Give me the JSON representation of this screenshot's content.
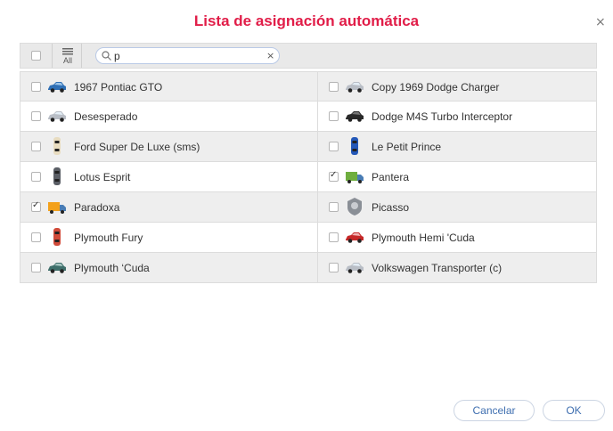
{
  "dialog": {
    "title": "Lista de asignación automática",
    "close_glyph": "×"
  },
  "toolbar": {
    "select_all_checked": false,
    "all_label": "All",
    "search": {
      "value": "p",
      "placeholder": "",
      "clear_glyph": "×"
    }
  },
  "items": [
    {
      "label": "1967 Pontiac GTO",
      "checked": false,
      "icon": "blue-sports-car-icon"
    },
    {
      "label": "Copy 1969 Dodge Charger",
      "checked": false,
      "icon": "silver-car-icon"
    },
    {
      "label": "Desesperado",
      "checked": false,
      "icon": "silver-car-icon"
    },
    {
      "label": "Dodge M4S Turbo Interceptor",
      "checked": false,
      "icon": "black-sports-car-icon"
    },
    {
      "label": "Ford Super De Luxe (sms)",
      "checked": false,
      "icon": "beige-car-top-icon"
    },
    {
      "label": "Le Petit Prince",
      "checked": false,
      "icon": "blue-car-top-icon"
    },
    {
      "label": "Lotus Esprit",
      "checked": false,
      "icon": "gray-car-top-icon"
    },
    {
      "label": "Pantera",
      "checked": true,
      "icon": "green-truck-icon"
    },
    {
      "label": "Paradoxa",
      "checked": true,
      "icon": "orange-truck-icon"
    },
    {
      "label": "Picasso",
      "checked": false,
      "icon": "crest-icon"
    },
    {
      "label": "Plymouth Fury",
      "checked": false,
      "icon": "red-car-top-icon"
    },
    {
      "label": "Plymouth Hemi 'Cuda",
      "checked": false,
      "icon": "red-sports-car-icon"
    },
    {
      "label": "Plymouth ‘Cuda",
      "checked": false,
      "icon": "teal-car-icon"
    },
    {
      "label": "Volkswagen Transporter (c)",
      "checked": false,
      "icon": "silver-car-icon"
    }
  ],
  "colors": {
    "title": "#e11d48",
    "button_text": "#3f6fb0"
  },
  "footer": {
    "cancel_label": "Cancelar",
    "ok_label": "OK"
  }
}
